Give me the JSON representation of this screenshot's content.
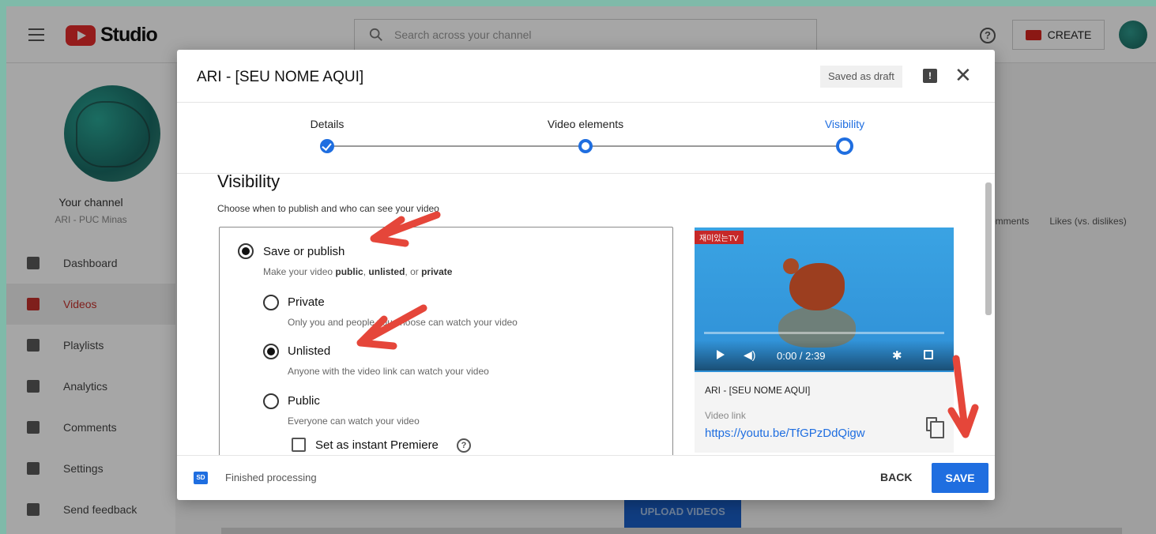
{
  "app": {
    "logo_text": "Studio",
    "search_placeholder": "Search across your channel",
    "help_glyph": "?",
    "create_label": "CREATE"
  },
  "sidebar": {
    "channel_title": "Your channel",
    "channel_name": "ARI - PUC Minas",
    "items": [
      {
        "label": "Dashboard",
        "icon": "dashboard-icon",
        "active": false
      },
      {
        "label": "Videos",
        "icon": "videos-icon",
        "active": true
      },
      {
        "label": "Playlists",
        "icon": "playlists-icon",
        "active": false
      },
      {
        "label": "Analytics",
        "icon": "analytics-icon",
        "active": false
      },
      {
        "label": "Comments",
        "icon": "comments-icon",
        "active": false
      },
      {
        "label": "Settings",
        "icon": "settings-icon",
        "active": false
      },
      {
        "label": "Send feedback",
        "icon": "feedback-icon",
        "active": false
      }
    ]
  },
  "background": {
    "col_comments": "omments",
    "col_likes": "Likes (vs. dislikes)",
    "upload_button": "UPLOAD VIDEOS"
  },
  "dialog": {
    "title": "ARI - [SEU NOME AQUI]",
    "draft_status": "Saved as draft",
    "feedback_glyph": "!",
    "close_glyph": "✕",
    "steps": [
      {
        "label": "Details",
        "state": "done"
      },
      {
        "label": "Video elements",
        "state": "pending"
      },
      {
        "label": "Visibility",
        "state": "current"
      }
    ],
    "visibility": {
      "heading": "Visibility",
      "description": "Choose when to publish and who can see your video",
      "save_publish_label": "Save or publish",
      "save_publish_sub_pre": "Make your video ",
      "save_publish_sub_public": "public",
      "save_publish_sub_mid1": ", ",
      "save_publish_sub_unlisted": "unlisted",
      "save_publish_sub_mid2": ", or ",
      "save_publish_sub_private": "private",
      "options": [
        {
          "label": "Private",
          "sub": "Only you and people you choose can watch your video",
          "selected": false
        },
        {
          "label": "Unlisted",
          "sub": "Anyone with the video link can watch your video",
          "selected": true
        },
        {
          "label": "Public",
          "sub": "Everyone can watch your video",
          "selected": false
        }
      ],
      "premiere_label": "Set as instant Premiere",
      "premiere_help_glyph": "?"
    },
    "preview": {
      "badge": "재미있는TV",
      "time": "0:00 / 2:39",
      "video_title": "ARI - [SEU NOME AQUI]",
      "link_label": "Video link",
      "link": "https://youtu.be/TfGPzDdQigw"
    },
    "footer": {
      "sd_badge": "SD",
      "status": "Finished processing",
      "back_label": "BACK",
      "save_label": "SAVE"
    }
  },
  "colors": {
    "accent": "#1f6ee0",
    "brand_red": "#e32b2b",
    "annotation_arrow": "#e5463a"
  }
}
